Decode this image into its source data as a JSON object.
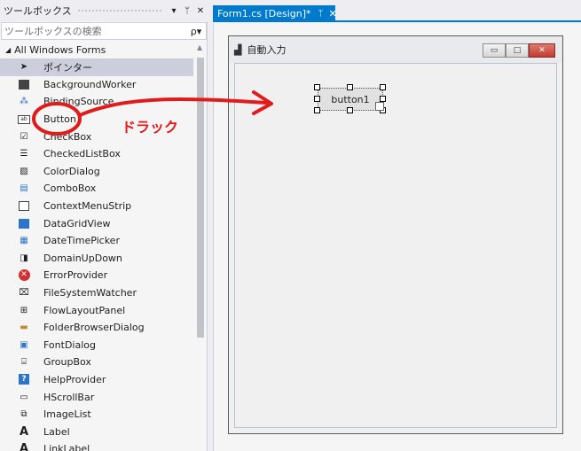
{
  "toolbox": {
    "title": "ツールボックス",
    "header_buttons": [
      "▾",
      "ᛘ",
      "✕"
    ],
    "search_placeholder": "ツールボックスの検索",
    "search_icon": "ρ▾",
    "category": "All Windows Forms",
    "items": [
      {
        "label": "ポインター",
        "icon": "pointer-icon"
      },
      {
        "label": "BackgroundWorker",
        "icon": "background-worker-icon"
      },
      {
        "label": "BindingSource",
        "icon": "binding-source-icon"
      },
      {
        "label": "Button",
        "icon": "button-icon"
      },
      {
        "label": "CheckBox",
        "icon": "checkbox-icon"
      },
      {
        "label": "CheckedListBox",
        "icon": "checked-listbox-icon"
      },
      {
        "label": "ColorDialog",
        "icon": "color-dialog-icon"
      },
      {
        "label": "ComboBox",
        "icon": "combobox-icon"
      },
      {
        "label": "ContextMenuStrip",
        "icon": "context-menu-icon"
      },
      {
        "label": "DataGridView",
        "icon": "datagrid-icon"
      },
      {
        "label": "DateTimePicker",
        "icon": "datetime-picker-icon"
      },
      {
        "label": "DomainUpDown",
        "icon": "domain-updown-icon"
      },
      {
        "label": "ErrorProvider",
        "icon": "error-provider-icon"
      },
      {
        "label": "FileSystemWatcher",
        "icon": "filesystem-watcher-icon"
      },
      {
        "label": "FlowLayoutPanel",
        "icon": "flow-layout-icon"
      },
      {
        "label": "FolderBrowserDialog",
        "icon": "folder-browser-icon"
      },
      {
        "label": "FontDialog",
        "icon": "font-dialog-icon"
      },
      {
        "label": "GroupBox",
        "icon": "groupbox-icon"
      },
      {
        "label": "HelpProvider",
        "icon": "help-provider-icon"
      },
      {
        "label": "HScrollBar",
        "icon": "hscrollbar-icon"
      },
      {
        "label": "ImageList",
        "icon": "imagelist-icon"
      },
      {
        "label": "Label",
        "icon": "label-icon"
      },
      {
        "label": "LinkLabel",
        "icon": "linklabel-icon"
      }
    ]
  },
  "document": {
    "tab_label": "Form1.cs [Design]*",
    "pin": "ᛘ",
    "close": "✕"
  },
  "form": {
    "title": "自動入力",
    "button_label": "button1",
    "controls": [
      "▭",
      "□",
      "✕"
    ]
  },
  "annotation": {
    "text": "ドラック",
    "color": "#e01b1b"
  },
  "colors": {
    "accent": "#007acc",
    "selected_item": "#cccedb"
  }
}
